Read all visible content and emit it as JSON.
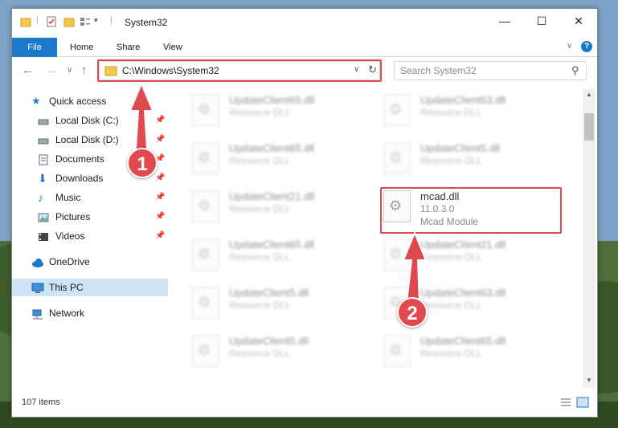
{
  "window": {
    "title": "System32",
    "controls": {
      "minimize": "—",
      "maximize": "☐",
      "close": "✕"
    }
  },
  "ribbon": {
    "tabs": [
      {
        "label": "File"
      },
      {
        "label": "Home"
      },
      {
        "label": "Share"
      },
      {
        "label": "View"
      }
    ]
  },
  "address": {
    "path": "C:\\Windows\\System32",
    "search_placeholder": "Search System32"
  },
  "sidebar": {
    "items": [
      {
        "label": "Quick access",
        "icon": "star-icon"
      },
      {
        "label": "Local Disk (C:)",
        "icon": "drive-icon"
      },
      {
        "label": "Local Disk (D:)",
        "icon": "drive-icon"
      },
      {
        "label": "Documents",
        "icon": "documents-icon"
      },
      {
        "label": "Downloads",
        "icon": "download-icon"
      },
      {
        "label": "Music",
        "icon": "music-icon"
      },
      {
        "label": "Pictures",
        "icon": "pictures-icon"
      },
      {
        "label": "Videos",
        "icon": "videos-icon"
      },
      {
        "label": "OneDrive",
        "icon": "cloud-icon"
      },
      {
        "label": "This PC",
        "icon": "computer-icon"
      },
      {
        "label": "Network",
        "icon": "network-icon"
      }
    ]
  },
  "files": {
    "left": [
      {
        "name": "UpdateClient65.dll",
        "desc": "Resource DLL"
      },
      {
        "name": "UpdateClient65.dll",
        "desc": "Resource DLL"
      },
      {
        "name": "UpdateClient21.dll",
        "desc": "Resource DLL"
      },
      {
        "name": "UpdateClient65.dll",
        "desc": "Resource DLL"
      },
      {
        "name": "UpdateClient5.dll",
        "desc": "Resource DLL"
      },
      {
        "name": "UpdateClient5.dll",
        "desc": "Resource DLL"
      }
    ],
    "right": [
      {
        "name": "UpdateClient63.dll",
        "desc": "Resource DLL"
      },
      {
        "name": "UpdateClient5.dll",
        "desc": "Resource DLL"
      },
      {
        "name": "UpdateClient21.dll",
        "desc": "Resource DLL"
      },
      {
        "name": "UpdateClient63.dll",
        "desc": "Resource DLL"
      },
      {
        "name": "UpdateClient65.dll",
        "desc": "Resource DLL"
      }
    ],
    "highlighted": {
      "name": "mcad.dll",
      "version": "11.0.3.0",
      "desc": "Mcad Module"
    }
  },
  "status": {
    "items_count": "107 items"
  },
  "annotations": {
    "badge1": "1",
    "badge2": "2"
  },
  "colors": {
    "accent": "#1979ca",
    "highlight": "#e04a4f",
    "selected": "#cce4f7"
  }
}
